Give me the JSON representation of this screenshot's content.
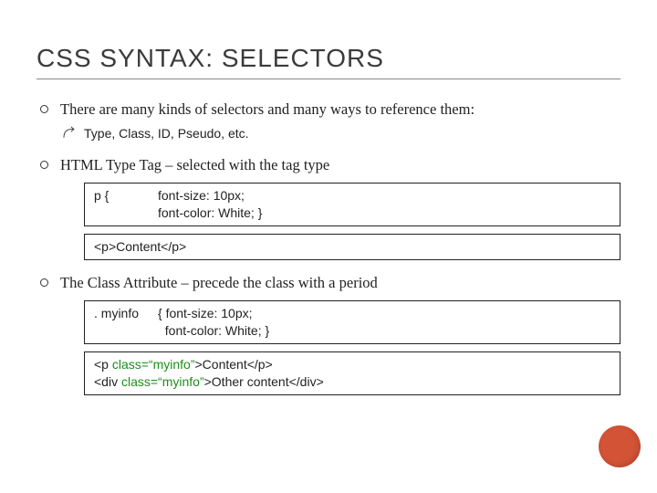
{
  "title": "CSS SYNTAX: SELECTORS",
  "bullets": {
    "b1": {
      "text": "There are many kinds of selectors and many ways to reference them:",
      "sub1": "Type, Class, ID, Pseudo, etc."
    },
    "b2": {
      "text": "HTML Type Tag – selected with the tag type",
      "code1_sel": "p {",
      "code1_rules": "font-size: 10px;\nfont-color: White; }",
      "code2": "<p>Content</p>"
    },
    "b3": {
      "text": "The Class Attribute – precede the class with a period",
      "code1_sel": ". myinfo",
      "code1_rules": "{ font-size: 10px;\n  font-color: White; }",
      "code2_l1a": "<p ",
      "code2_l1b": "class=“myinfo”",
      "code2_l1c": ">Content</p>",
      "code2_l2a": "<div ",
      "code2_l2b": "class=“myinfo”",
      "code2_l2c": ">Other content</div>"
    }
  }
}
